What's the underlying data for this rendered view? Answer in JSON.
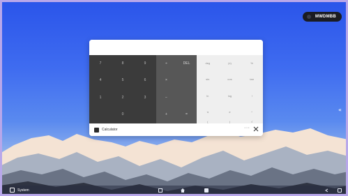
{
  "user_label": "MWDMBB",
  "calculator": {
    "title": "Calculator",
    "more_label": "···",
    "number_keys": [
      "7",
      "8",
      "9",
      "4",
      "5",
      "6",
      "1",
      "2",
      "3",
      "",
      "0",
      ""
    ],
    "operator_keys": [
      "÷",
      "DEL",
      "×",
      "",
      "−",
      "",
      "+",
      "="
    ],
    "function_keys": [
      "deg",
      "(x)",
      "%",
      "sin",
      "cos",
      "tan",
      "ln",
      "log",
      "!",
      "π",
      "e",
      "^",
      "(",
      ")",
      "√"
    ]
  },
  "taskbar": {
    "system_label": "System"
  },
  "side_arrow": "«"
}
